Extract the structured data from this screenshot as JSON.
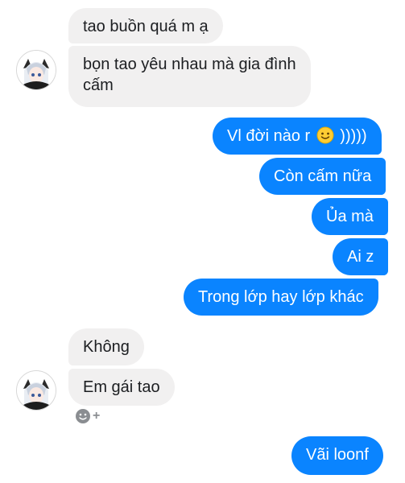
{
  "chat": {
    "messages": [
      {
        "text": "tao buồn quá m ạ"
      },
      {
        "line1": "bọn tao yêu nhau mà gia đình",
        "line2": "cấm"
      },
      {
        "before": "Vl đời nào r",
        "after": ")))))"
      },
      {
        "text": "Còn cấm nữa"
      },
      {
        "text": "Ủa mà"
      },
      {
        "text": "Ai z"
      },
      {
        "text": "Trong lớp hay lớp khác"
      },
      {
        "text": "Không"
      },
      {
        "text": "Em gái tao"
      },
      {
        "text": "Vãi loonf"
      }
    ],
    "react_plus": "+"
  },
  "colors": {
    "incoming_bubble": "#f1f0f0",
    "outgoing_bubble": "#0a84ff"
  },
  "icons": [
    "contact-avatar",
    "slightly-smiling-face-emoji",
    "add-reaction-icon"
  ]
}
